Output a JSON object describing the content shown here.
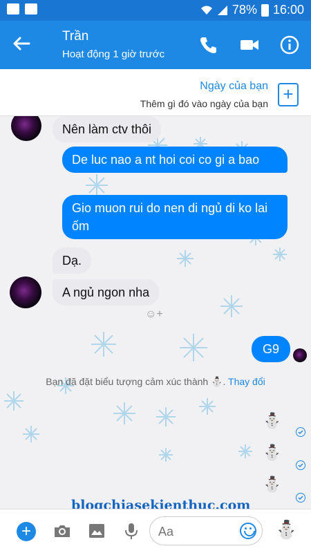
{
  "status_bar": {
    "battery": "78%",
    "time": "16:00"
  },
  "header": {
    "contact_name": "Trần",
    "contact_status": "Hoạt động 1 giờ trước",
    "icons": [
      "back-arrow-icon",
      "phone-icon",
      "video-icon",
      "info-icon"
    ],
    "accent": "#1e88e5"
  },
  "date_bar": {
    "title": "Ngày của bạn",
    "subtitle": "Thêm gì đó vào ngày của bạn",
    "plus": "+"
  },
  "messages": {
    "m1": "Nên làm ctv thôi",
    "m2": "De luc nao a nt hoi coi co gi a bao",
    "m3": "Gio muon rui do nen di ngủ di ko lai ốm",
    "m4": "Dạ.",
    "m5": "A ngủ ngon nha",
    "m6": "G9",
    "reaction": "☺+"
  },
  "system_note": {
    "text": "Bạn đã đặt biểu tượng cảm xúc thành ⛄.",
    "link": "Thay đổi"
  },
  "snowmen": [
    "⛄",
    "⛄",
    "⛄"
  ],
  "watermark": "blogchiasekienthuc.com",
  "composer": {
    "placeholder": "Aa",
    "plus": "+",
    "snowman": "⛄",
    "icons": [
      "camera-icon",
      "image-icon",
      "microphone-icon",
      "emoji-icon"
    ]
  },
  "colors": {
    "outgoing": "#0084ff",
    "incoming": "#e9e9ee",
    "header": "#1e88e5"
  }
}
